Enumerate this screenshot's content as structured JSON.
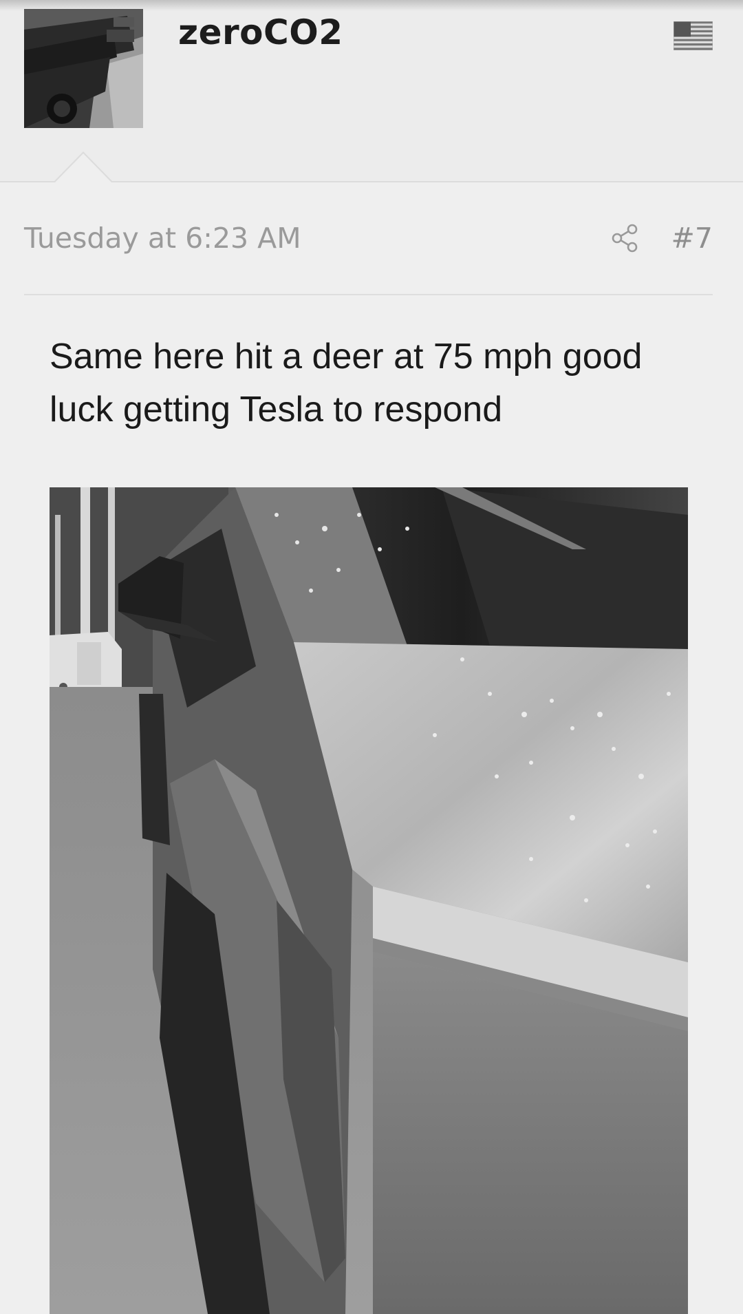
{
  "post": {
    "username": "zeroCO2",
    "avatar_icon": "cybertruck-avatar",
    "flag_icon": "us-flag-icon",
    "date": "Tuesday at 6:23 AM",
    "share_icon": "share-icon",
    "number": "#7",
    "body": "Same here hit a deer at 75 mph good luck getting Tesla to respond",
    "attachment_icon": "damaged-cybertruck-photo"
  },
  "colors": {
    "background": "#efefef",
    "header": "#ececec",
    "muted_text": "#9a9a9a",
    "body_text": "#1a1a1a"
  }
}
